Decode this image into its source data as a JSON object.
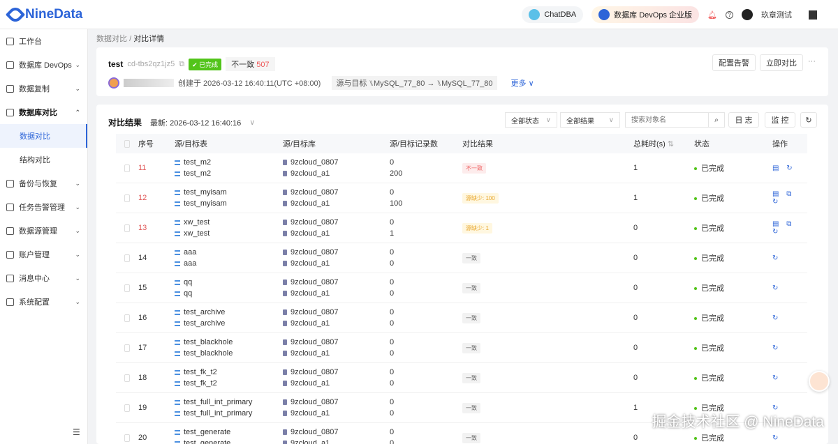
{
  "header": {
    "logo": "NineData",
    "chatdba": "ChatDBA",
    "edition": "数据库 DevOps 企业版",
    "user": "玖章测试"
  },
  "sidebar": {
    "items": [
      {
        "label": "工作台",
        "chev": false
      },
      {
        "label": "数据库 DevOps",
        "chev": true
      },
      {
        "label": "数据复制",
        "chev": true
      },
      {
        "label": "数据库对比",
        "chev": true,
        "open": true
      },
      {
        "label": "数据对比",
        "sub": true,
        "active": true
      },
      {
        "label": "结构对比",
        "sub": true
      },
      {
        "label": "备份与恢复",
        "chev": true
      },
      {
        "label": "任务告警管理",
        "chev": true
      },
      {
        "label": "数据源管理",
        "chev": true
      },
      {
        "label": "账户管理",
        "chev": true
      },
      {
        "label": "消息中心",
        "chev": true
      },
      {
        "label": "系统配置",
        "chev": true
      }
    ]
  },
  "breadcrumb": {
    "parent": "数据对比",
    "sep": "/",
    "current": "对比详情"
  },
  "task": {
    "name": "test",
    "id": "cd-tbs2qz1jz5",
    "status": "已完成",
    "inconsistent_label": "不一致",
    "inconsistent_count": "507",
    "created": "创建于 2026-03-12 16:40:11(UTC +08:00)",
    "src_tgt_label": "源与目标",
    "source": "MySQL_77_80",
    "arrow": "→",
    "target": "MySQL_77_80",
    "more": "更多",
    "alert_btn": "配置告警",
    "compare_btn": "立即对比",
    "ellipsis": "···"
  },
  "results": {
    "title": "对比结果",
    "latest": "最新: 2026-03-12 16:40:16",
    "status_filter": "全部状态",
    "result_filter": "全部结果",
    "search_placeholder": "搜索对象名",
    "log_btn": "日 志",
    "monitor_btn": "监 控",
    "columns": [
      "序号",
      "源/目标表",
      "源/目标库",
      "源/目标记录数",
      "对比结果",
      "总耗时(s)",
      "状态",
      "操作"
    ],
    "rows": [
      {
        "no": "11",
        "st": "test_m2",
        "tt": "test_m2",
        "sd": "9zcloud_0807",
        "td": "9zcloud_a1",
        "sn": "0",
        "tn": "200",
        "res": "不一致",
        "kind": "bad",
        "time": "1",
        "status": "已完成",
        "ops": "▤ ↻"
      },
      {
        "no": "12",
        "st": "test_myisam",
        "tt": "test_myisam",
        "sd": "9zcloud_0807",
        "td": "9zcloud_a1",
        "sn": "0",
        "tn": "100",
        "res": "源缺少: 100",
        "kind": "warn",
        "time": "1",
        "status": "已完成",
        "ops": "▤ ⧉ ↻"
      },
      {
        "no": "13",
        "st": "xw_test",
        "tt": "xw_test",
        "sd": "9zcloud_0807",
        "td": "9zcloud_a1",
        "sn": "0",
        "tn": "1",
        "res": "源缺少: 1",
        "kind": "warn",
        "time": "0",
        "status": "已完成",
        "ops": "▤ ⧉ ↻"
      },
      {
        "no": "14",
        "st": "aaa",
        "tt": "aaa",
        "sd": "9zcloud_0807",
        "td": "9zcloud_a1",
        "sn": "0",
        "tn": "0",
        "res": "一致",
        "kind": "ok",
        "time": "0",
        "status": "已完成",
        "ops": "↻"
      },
      {
        "no": "15",
        "st": "qq",
        "tt": "qq",
        "sd": "9zcloud_0807",
        "td": "9zcloud_a1",
        "sn": "0",
        "tn": "0",
        "res": "一致",
        "kind": "ok",
        "time": "0",
        "status": "已完成",
        "ops": "↻"
      },
      {
        "no": "16",
        "st": "test_archive",
        "tt": "test_archive",
        "sd": "9zcloud_0807",
        "td": "9zcloud_a1",
        "sn": "0",
        "tn": "0",
        "res": "一致",
        "kind": "ok",
        "time": "0",
        "status": "已完成",
        "ops": "↻"
      },
      {
        "no": "17",
        "st": "test_blackhole",
        "tt": "test_blackhole",
        "sd": "9zcloud_0807",
        "td": "9zcloud_a1",
        "sn": "0",
        "tn": "0",
        "res": "一致",
        "kind": "ok",
        "time": "0",
        "status": "已完成",
        "ops": "↻"
      },
      {
        "no": "18",
        "st": "test_fk_t2",
        "tt": "test_fk_t2",
        "sd": "9zcloud_0807",
        "td": "9zcloud_a1",
        "sn": "0",
        "tn": "0",
        "res": "一致",
        "kind": "ok",
        "time": "0",
        "status": "已完成",
        "ops": "↻"
      },
      {
        "no": "19",
        "st": "test_full_int_primary",
        "tt": "test_full_int_primary",
        "sd": "9zcloud_0807",
        "td": "9zcloud_a1",
        "sn": "0",
        "tn": "0",
        "res": "一致",
        "kind": "ok",
        "time": "1",
        "status": "已完成",
        "ops": "↻"
      },
      {
        "no": "20",
        "st": "test_generate",
        "tt": "test_generate",
        "sd": "9zcloud_0807",
        "td": "9zcloud_a1",
        "sn": "0",
        "tn": "0",
        "res": "一致",
        "kind": "ok",
        "time": "0",
        "status": "已完成",
        "ops": "↻"
      }
    ]
  },
  "watermark": "掘金技术社区 @ NineData"
}
